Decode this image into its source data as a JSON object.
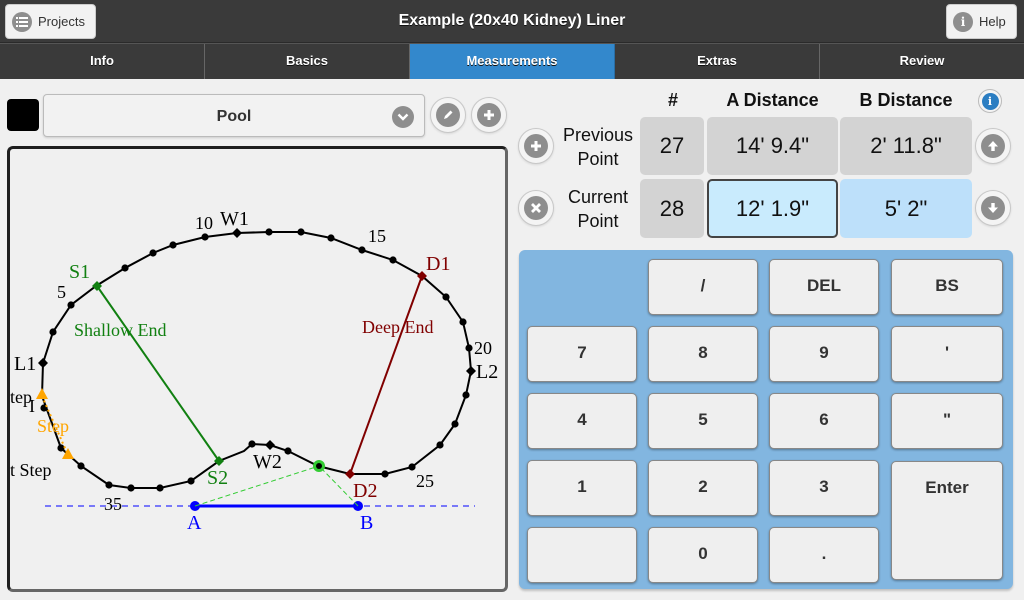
{
  "header": {
    "title": "Example (20x40 Kidney) Liner",
    "projects_label": "Projects",
    "help_label": "Help"
  },
  "tabs": [
    {
      "label": "Info",
      "active": false
    },
    {
      "label": "Basics",
      "active": false
    },
    {
      "label": "Measurements",
      "active": true
    },
    {
      "label": "Extras",
      "active": false
    },
    {
      "label": "Review",
      "active": false
    }
  ],
  "shape_selector": {
    "swatch_color": "#000000",
    "selected": "Pool"
  },
  "measurements": {
    "columns": {
      "number": "#",
      "a_distance": "A Distance",
      "b_distance": "B Distance"
    },
    "previous": {
      "label_line1": "Previous",
      "label_line2": "Point",
      "number": "27",
      "a": "14' 9.4\"",
      "b": "2' 11.8\""
    },
    "current": {
      "label_line1": "Current",
      "label_line2": "Point",
      "number": "28",
      "a": "12' 1.9\"",
      "b": "5' 2\""
    }
  },
  "keypad": {
    "keys": [
      "/",
      "DEL",
      "BS",
      "7",
      "8",
      "9",
      "'",
      "4",
      "5",
      "6",
      "\"",
      "1",
      "2",
      "3",
      "Enter",
      "",
      "0",
      "."
    ]
  },
  "diagram": {
    "labels": {
      "n5": "5",
      "n10": "10",
      "n15": "15",
      "n20": "20",
      "n25": "25",
      "n35": "35",
      "w1": "W1",
      "w2": "W2",
      "l1": "L1",
      "l2": "L2",
      "s1": "S1",
      "s2": "S2",
      "d1": "D1",
      "d2": "D2",
      "shallow_end": "Shallow End",
      "deep_end": "Deep End",
      "step": "Step",
      "step_left": "tep",
      "step_left2": "t Step",
      "step_i": "I",
      "a": "A",
      "b": "B"
    },
    "colors": {
      "outline": "#000000",
      "shallow": "#118011",
      "deep": "#800000",
      "step": "#ffa500",
      "baseline": "#0000ff",
      "current_point": "#33cc33"
    }
  }
}
